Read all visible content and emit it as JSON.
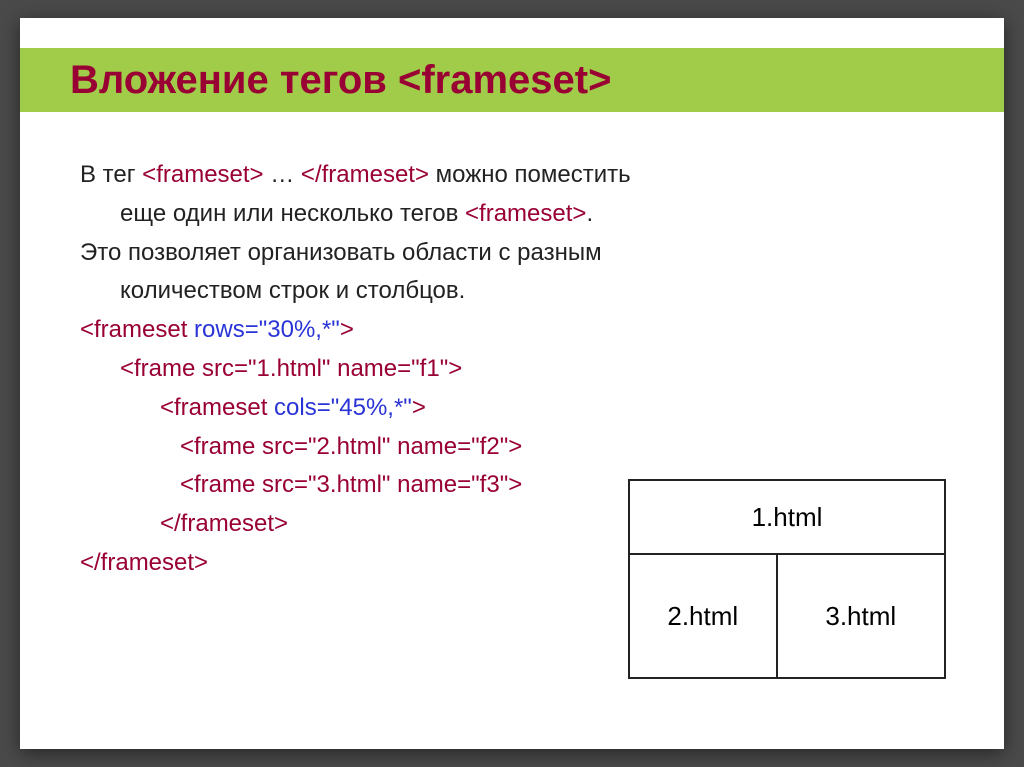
{
  "title": "Вложение тегов <frameset>",
  "para1": {
    "pre": "В тег ",
    "tag1": "<frameset>",
    "mid1": " … ",
    "tag2": "</frameset>",
    "mid2": " можно поместить",
    "line2": "еще один или несколько тегов ",
    "tag3": "<frameset>",
    "end": "."
  },
  "para2": {
    "line1": "Это позволяет организовать области с разным",
    "line2": "количеством строк и столбцов."
  },
  "code": {
    "l1a": "<frameset ",
    "l1b": "rows=\"30%,*\"",
    "l1c": ">",
    "l2": "<frame src=\"1.html\" name=\"f1\">",
    "l3a": "<frameset ",
    "l3b": "cols=\"45%,*\"",
    "l3c": ">",
    "l4": "<frame src=\"2.html\" name=\"f2\">",
    "l5": "<frame src=\"3.html\" name=\"f3\">",
    "l6": "</frameset>",
    "l7": "</frameset>"
  },
  "diagram": {
    "top": "1.html",
    "left": "2.html",
    "right": "3.html"
  }
}
